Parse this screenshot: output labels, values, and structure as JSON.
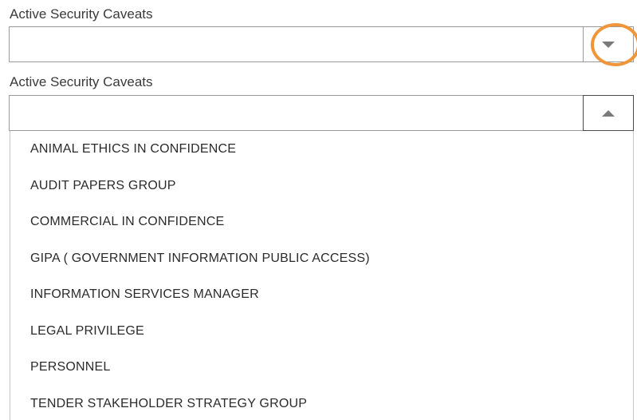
{
  "field_1": {
    "label": "Active Security Caveats",
    "value": "",
    "state": "collapsed",
    "toggle_icon": "chevron-down-icon"
  },
  "field_2": {
    "label": "Active Security Caveats",
    "value": "",
    "state": "expanded",
    "toggle_icon": "chevron-up-icon",
    "options": [
      "ANIMAL ETHICS IN CONFIDENCE",
      "AUDIT PAPERS GROUP",
      "COMMERCIAL IN CONFIDENCE",
      "GIPA ( GOVERNMENT INFORMATION PUBLIC ACCESS)",
      "INFORMATION SERVICES MANAGER",
      "LEGAL PRIVILEGE",
      "PERSONNEL",
      "TENDER STAKEHOLDER STRATEGY GROUP"
    ]
  },
  "colors": {
    "highlight_ring": "#f0963a",
    "border": "#9a9a9a",
    "icon": "#7a7a7a",
    "text": "#2b2b2b"
  }
}
